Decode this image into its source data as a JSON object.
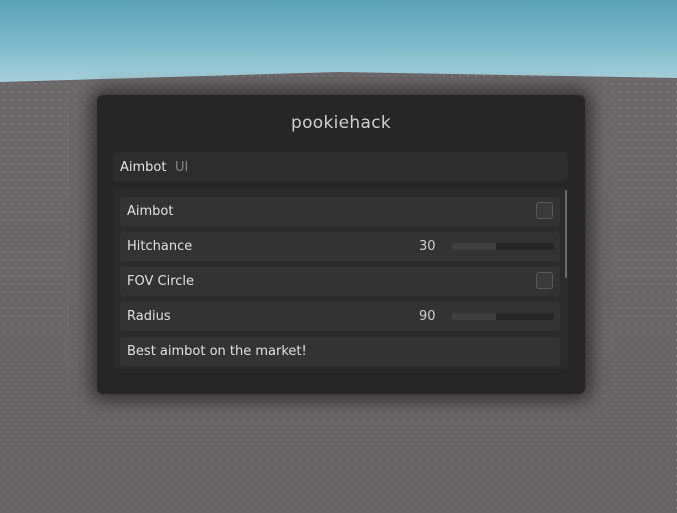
{
  "window": {
    "title": "pookiehack"
  },
  "tabs": [
    {
      "label": "Aimbot",
      "active": true
    },
    {
      "label": "UI",
      "active": false
    }
  ],
  "controls": {
    "aimbot_toggle": {
      "label": "Aimbot",
      "checked": false
    },
    "hitchance": {
      "label": "Hitchance",
      "value": "30"
    },
    "fov_circle_toggle": {
      "label": "FOV Circle",
      "checked": false
    },
    "radius": {
      "label": "Radius",
      "value": "90"
    },
    "description": {
      "label": "Best aimbot on the market!"
    }
  },
  "colors": {
    "window_bg": "#262626",
    "row_bg": "#333333",
    "text": "#e0e0e0",
    "inactive_tab": "#858585"
  }
}
